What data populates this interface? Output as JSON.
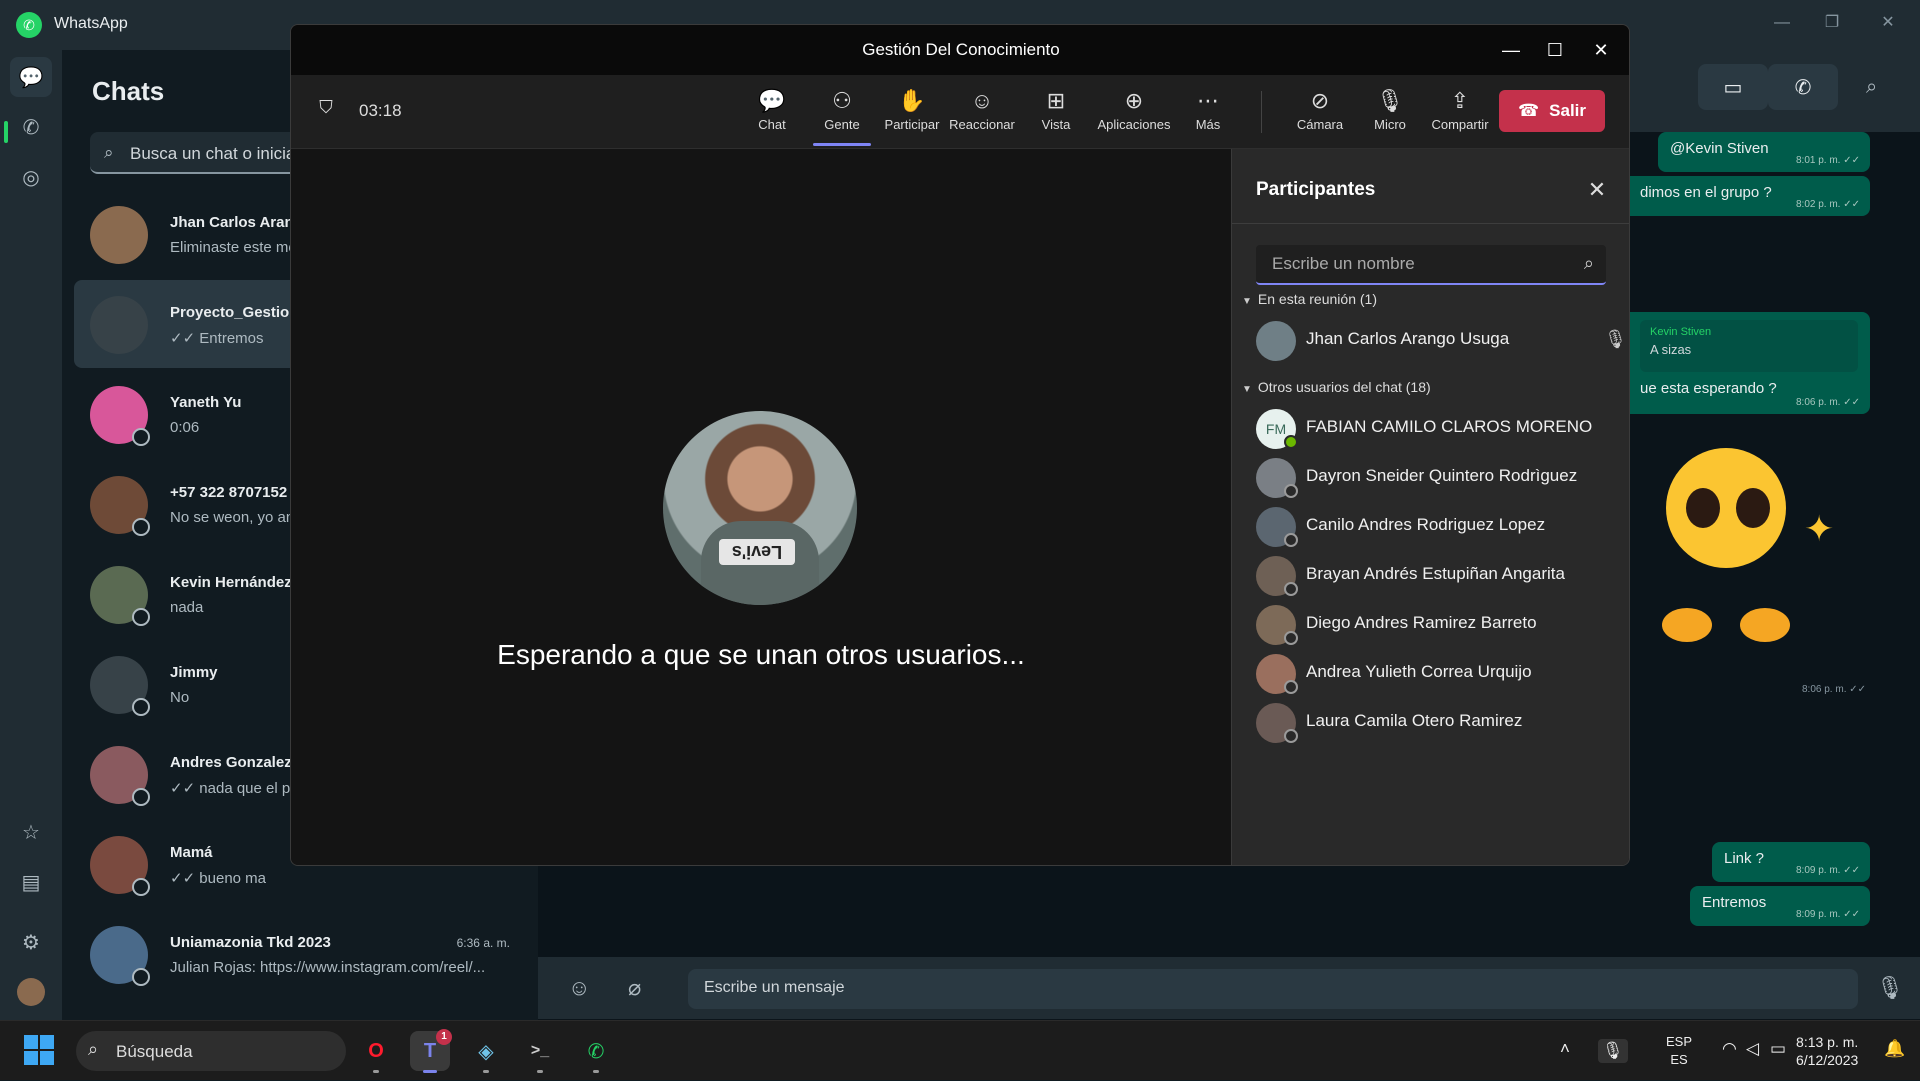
{
  "whatsapp": {
    "app_title": "WhatsApp",
    "chats_title": "Chats",
    "search_placeholder": "Busca un chat o inicia uno nuevo",
    "chats": [
      {
        "name": "Jhan Carlos Arango",
        "preview": "Eliminaste este mensaje",
        "time": "",
        "avatar": "#8a6a4f"
      },
      {
        "name": "Proyecto_Gestion_",
        "preview": "✓✓ Entremos",
        "time": "",
        "avatar": "#374248"
      },
      {
        "name": "Yaneth Yu",
        "preview": "0:06",
        "time": "",
        "avatar": "#d8579a"
      },
      {
        "name": "+57 322 8707152",
        "preview": "No se weon, yo an",
        "time": "",
        "avatar": "#6e4a37"
      },
      {
        "name": "Kevin Hernández",
        "preview": "nada",
        "time": "",
        "avatar": "#5a6a52"
      },
      {
        "name": "Jimmy",
        "preview": "No",
        "time": "",
        "avatar": "#374248"
      },
      {
        "name": "Andres Gonzalez",
        "preview": "✓✓ nada que el pro",
        "time": "",
        "avatar": "#8a5a5f"
      },
      {
        "name": "Mamá",
        "preview": "✓✓ bueno ma",
        "time": "",
        "avatar": "#7a4a3f"
      },
      {
        "name": "Uniamazonia Tkd 2023",
        "preview": "Julian Rojas: https://www.instagram.com/reel/...",
        "time": "6:36 a. m.",
        "avatar": "#4a6a8a"
      }
    ],
    "messages": [
      {
        "text": "@Kevin Stiven",
        "time": "8:01 p. m. ✓✓"
      },
      {
        "text": "dimos en el grupo ?",
        "time": "8:02 p. m. ✓✓"
      },
      {
        "quote_author": "Kevin Stiven",
        "quote_text": "A sizas",
        "text": "ue esta esperando ?",
        "time": "8:06 p. m. ✓✓"
      },
      {
        "sticker_time": "8:06 p. m. ✓✓"
      },
      {
        "text": "Link ?",
        "time": "8:09 p. m. ✓✓"
      },
      {
        "text": "Entremos",
        "time": "8:09 p. m. ✓✓"
      }
    ],
    "compose_placeholder": "Escribe un mensaje"
  },
  "call": {
    "title": "Gestión Del Conocimiento",
    "timer": "03:18",
    "toolbar": [
      "Chat",
      "Gente",
      "Participar",
      "Reaccionar",
      "Vista",
      "Aplicaciones",
      "Más",
      "Cámara",
      "Micro",
      "Compartir"
    ],
    "leave_label": "Salir",
    "waiting_text": "Esperando a que se unan otros usuarios...",
    "panel": {
      "title": "Participantes",
      "search_placeholder": "Escribe un nombre",
      "in_meeting_header": "En esta reunión (1)",
      "in_meeting": [
        {
          "name": "Jhan Carlos Arango Usuga",
          "color": "#6f7f86"
        }
      ],
      "others_header": "Otros usuarios del chat (18)",
      "others": [
        {
          "name": "FABIAN CAMILO CLAROS MORENO",
          "initials": "FM",
          "color": "#e7f1ee",
          "online": true
        },
        {
          "name": "Dayron Sneider Quintero Rodrìguez",
          "initials": "",
          "color": "#7a7f85",
          "online": false
        },
        {
          "name": "Canilo Andres Rodriguez Lopez",
          "initials": "",
          "color": "#5b6670",
          "online": false
        },
        {
          "name": "Brayan Andrés Estupiñan Angarita",
          "initials": "",
          "color": "#6e6055",
          "online": false
        },
        {
          "name": "Diego Andres Ramirez Barreto",
          "initials": "",
          "color": "#7d6a58",
          "online": false
        },
        {
          "name": "Andrea Yulieth Correa Urquijo",
          "initials": "",
          "color": "#9a6f5e",
          "online": false
        },
        {
          "name": "Laura Camila Otero Ramirez",
          "initials": "",
          "color": "#6a5a55",
          "online": false
        }
      ]
    }
  },
  "taskbar": {
    "search_label": "Búsqueda",
    "teams_badge": "1",
    "lang_line1": "ESP",
    "lang_line2": "ES",
    "time": "8:13 p. m.",
    "date": "6/12/2023"
  }
}
